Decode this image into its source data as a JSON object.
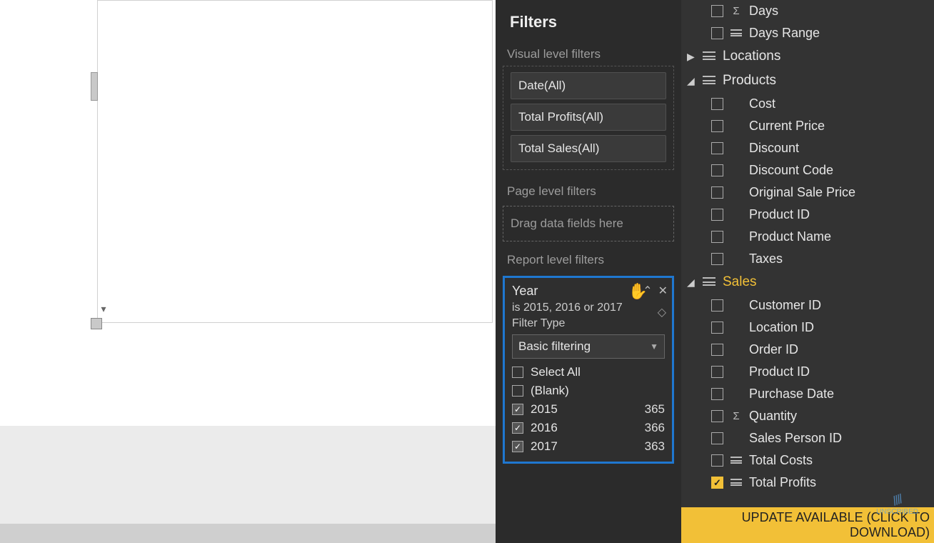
{
  "filters": {
    "title": "Filters",
    "visual_section": "Visual level filters",
    "visual_chips": [
      "Date(All)",
      "Total Profits(All)",
      "Total Sales(All)"
    ],
    "page_section": "Page level filters",
    "page_placeholder": "Drag data fields here",
    "report_section": "Report level filters",
    "year_card": {
      "title": "Year",
      "summary": "is 2015, 2016 or 2017",
      "type_label": "Filter Type",
      "type_value": "Basic filtering",
      "options": [
        {
          "label": "Select All",
          "checked": false,
          "count": ""
        },
        {
          "label": "(Blank)",
          "checked": false,
          "count": ""
        },
        {
          "label": "2015",
          "checked": true,
          "count": "365"
        },
        {
          "label": "2016",
          "checked": true,
          "count": "366"
        },
        {
          "label": "2017",
          "checked": true,
          "count": "363"
        }
      ]
    }
  },
  "fields": {
    "top_visible": [
      {
        "label": "Days",
        "icon": "sigma",
        "checked": false
      },
      {
        "label": "Days Range",
        "icon": "table",
        "checked": false
      }
    ],
    "tables": [
      {
        "name": "Locations",
        "expanded": false,
        "selected": false,
        "fields": []
      },
      {
        "name": "Products",
        "expanded": true,
        "selected": false,
        "fields": [
          {
            "label": "Cost",
            "checked": false,
            "icon": "none"
          },
          {
            "label": "Current Price",
            "checked": false,
            "icon": "none"
          },
          {
            "label": "Discount",
            "checked": false,
            "icon": "none"
          },
          {
            "label": "Discount Code",
            "checked": false,
            "icon": "none"
          },
          {
            "label": "Original Sale Price",
            "checked": false,
            "icon": "none"
          },
          {
            "label": "Product ID",
            "checked": false,
            "icon": "none"
          },
          {
            "label": "Product Name",
            "checked": false,
            "icon": "none"
          },
          {
            "label": "Taxes",
            "checked": false,
            "icon": "none"
          }
        ]
      },
      {
        "name": "Sales",
        "expanded": true,
        "selected": true,
        "fields": [
          {
            "label": "Customer ID",
            "checked": false,
            "icon": "none"
          },
          {
            "label": "Location ID",
            "checked": false,
            "icon": "none"
          },
          {
            "label": "Order ID",
            "checked": false,
            "icon": "none"
          },
          {
            "label": "Product ID",
            "checked": false,
            "icon": "none"
          },
          {
            "label": "Purchase Date",
            "checked": false,
            "icon": "none"
          },
          {
            "label": "Quantity",
            "checked": false,
            "icon": "sigma"
          },
          {
            "label": "Sales Person ID",
            "checked": false,
            "icon": "none"
          },
          {
            "label": "Total Costs",
            "checked": false,
            "icon": "table"
          },
          {
            "label": "Total Profits",
            "checked": true,
            "icon": "table"
          }
        ]
      }
    ]
  },
  "update_bar": "UPDATE AVAILABLE (CLICK TO DOWNLOAD)",
  "watermark": "UNSCRIBED"
}
